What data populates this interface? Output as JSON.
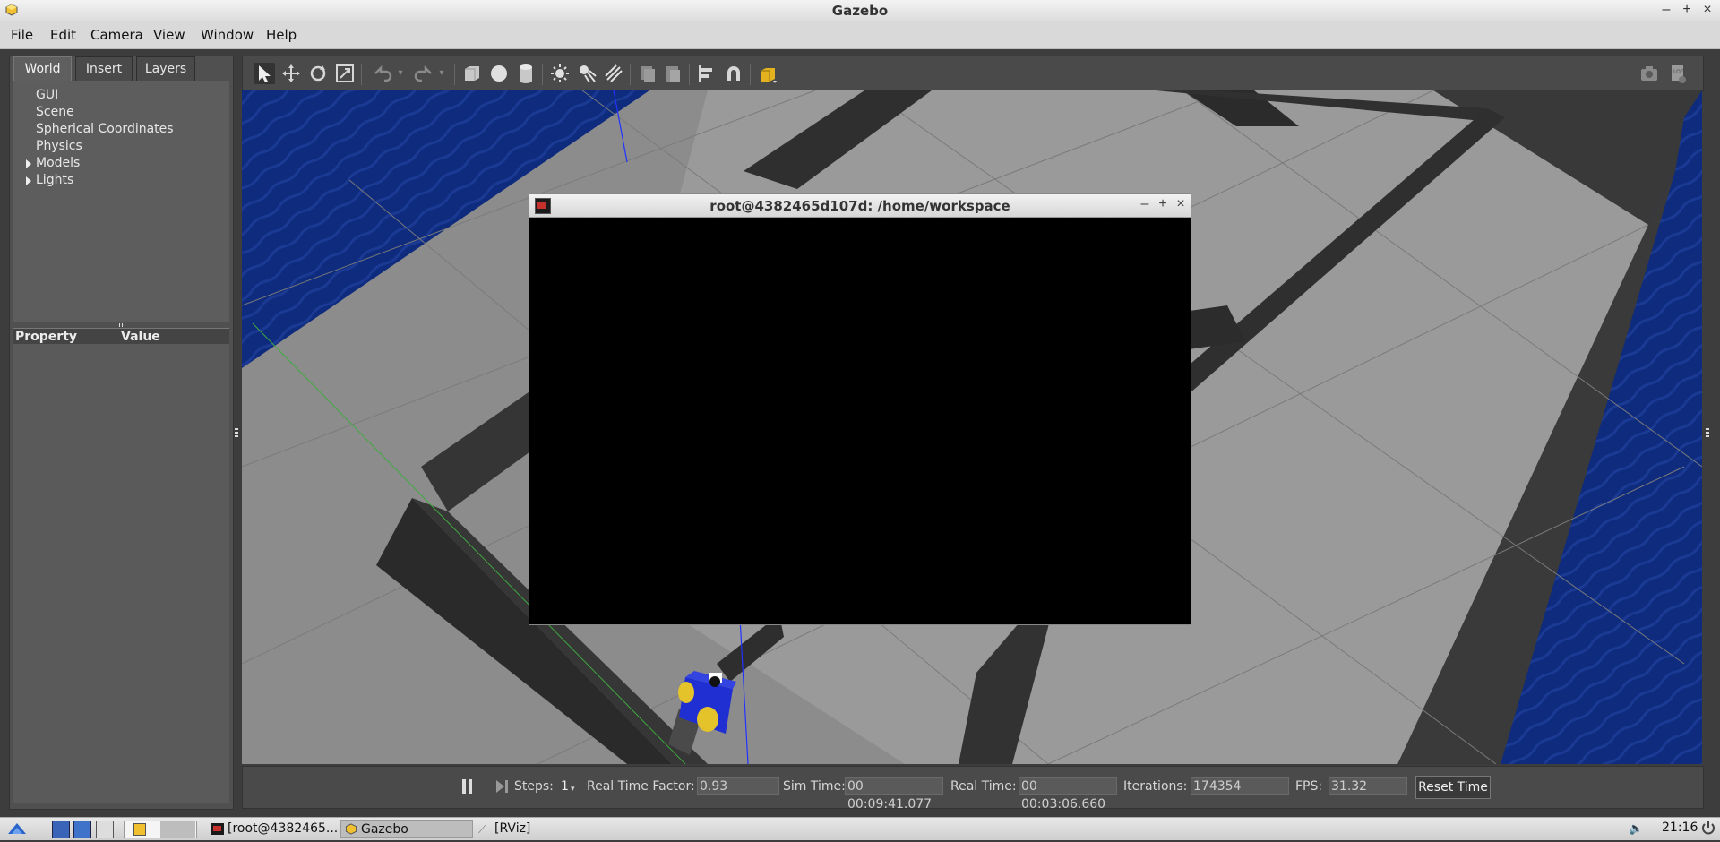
{
  "window": {
    "title": "Gazebo",
    "controls": [
      "–",
      "+",
      "×"
    ]
  },
  "menu": [
    "File",
    "Edit",
    "Camera",
    "View",
    "Window",
    "Help"
  ],
  "left_panel": {
    "tabs": [
      "World",
      "Insert",
      "Layers"
    ],
    "active_tab": "World",
    "tree": [
      {
        "label": "GUI",
        "expandable": false
      },
      {
        "label": "Scene",
        "expandable": false
      },
      {
        "label": "Spherical Coordinates",
        "expandable": false
      },
      {
        "label": "Physics",
        "expandable": false
      },
      {
        "label": "Models",
        "expandable": true
      },
      {
        "label": "Lights",
        "expandable": true
      }
    ],
    "property_header": {
      "property": "Property",
      "value": "Value"
    }
  },
  "toolbar": {
    "icons": [
      "select-arrow-icon",
      "translate-icon",
      "rotate-icon",
      "scale-icon",
      "undo-icon",
      "redo-icon",
      "box-icon",
      "sphere-icon",
      "cylinder-icon",
      "point-light-icon",
      "spot-light-icon",
      "directional-light-icon",
      "copy-icon",
      "paste-icon",
      "align-icon",
      "magnet-icon",
      "view-angle-icon",
      "screenshot-icon",
      "log-icon"
    ]
  },
  "terminal": {
    "title": "root@4382465d107d: /home/workspace",
    "controls": [
      "–",
      "+",
      "×"
    ]
  },
  "bottom_bar": {
    "steps_label": "Steps:",
    "steps_value": "1",
    "rtf_label": "Real Time Factor:",
    "rtf_value": "0.93",
    "sim_time_label": "Sim Time:",
    "sim_time_value": "00 00:09:41.077",
    "real_time_label": "Real Time:",
    "real_time_value": "00 00:03:06.660",
    "iterations_label": "Iterations:",
    "iterations_value": "174354",
    "fps_label": "FPS:",
    "fps_value": "31.32",
    "reset_label": "Reset Time"
  },
  "taskbar": {
    "tasks": [
      "[root@4382465...",
      "Gazebo",
      "[RViz]"
    ],
    "clock": "21:16"
  },
  "colors": {
    "ground": "#8f8f8f",
    "walls": "#353535",
    "water": "#0c2a7c",
    "robot": "#1f2fd1",
    "wheels": "#e3c22a"
  }
}
